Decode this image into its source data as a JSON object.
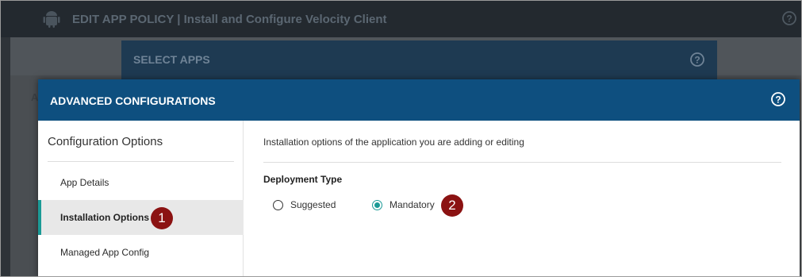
{
  "background_app": {
    "title": "EDIT APP POLICY  |  Install and Configure Velocity Client",
    "partial_letter": "A"
  },
  "select_apps_modal": {
    "title": "SELECT APPS"
  },
  "advanced_modal": {
    "title": "ADVANCED CONFIGURATIONS",
    "sidebar": {
      "heading": "Configuration Options",
      "items": [
        {
          "label": "App Details",
          "active": false
        },
        {
          "label": "Installation Options",
          "active": true
        },
        {
          "label": "Managed App Config",
          "active": false
        }
      ]
    },
    "content": {
      "description": "Installation options of the application you are adding or editing",
      "deployment_type": {
        "label": "Deployment Type",
        "options": [
          {
            "label": "Suggested",
            "selected": false
          },
          {
            "label": "Mandatory",
            "selected": true
          }
        ]
      }
    }
  },
  "callouts": {
    "one": "1",
    "two": "2"
  },
  "colors": {
    "header_blue": "#0e4f7f",
    "accent_teal": "#1b9a96",
    "callout_red": "#8b1212"
  },
  "icons": [
    "android-icon",
    "help-circle-icon"
  ]
}
